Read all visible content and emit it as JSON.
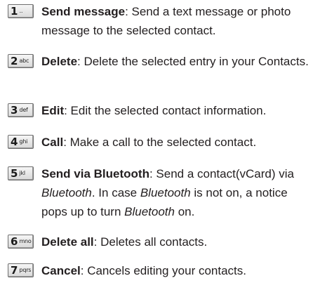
{
  "items": [
    {
      "key_number": "1",
      "key_letters": "․․",
      "key_icon": "voicemail-icon",
      "term": "Send message",
      "desc_parts": [
        {
          "text": ": Send a text message or photo message to the selected contact.",
          "italic": false
        }
      ]
    },
    {
      "key_number": "2",
      "key_letters": "abc",
      "term": "Delete",
      "desc_parts": [
        {
          "text": ": Delete the selected entry in your Contacts.",
          "italic": false
        }
      ]
    },
    {
      "key_number": "3",
      "key_letters": "def",
      "term": "Edit",
      "desc_parts": [
        {
          "text": ": Edit the selected contact information.",
          "italic": false
        }
      ]
    },
    {
      "key_number": "4",
      "key_letters": "ghi",
      "term": "Call",
      "desc_parts": [
        {
          "text": ": Make a call to the selected contact.",
          "italic": false
        }
      ]
    },
    {
      "key_number": "5",
      "key_letters": "jkl",
      "term": "Send via Bluetooth",
      "desc_parts": [
        {
          "text": ": Send a contact(vCard) via ",
          "italic": false
        },
        {
          "text": "Bluetooth",
          "italic": true
        },
        {
          "text": ". In case ",
          "italic": false
        },
        {
          "text": "Bluetooth",
          "italic": true
        },
        {
          "text": " is not on, a notice pops up to turn ",
          "italic": false
        },
        {
          "text": "Bluetooth",
          "italic": true
        },
        {
          "text": " on.",
          "italic": false
        }
      ]
    },
    {
      "key_number": "6",
      "key_letters": "mno",
      "term": "Delete all",
      "desc_parts": [
        {
          "text": ": Deletes all contacts.",
          "italic": false
        }
      ]
    },
    {
      "key_number": "7",
      "key_letters": "pqrs",
      "term": "Cancel",
      "desc_parts": [
        {
          "text": ": Cancels editing your contacts.",
          "italic": false
        }
      ]
    }
  ]
}
